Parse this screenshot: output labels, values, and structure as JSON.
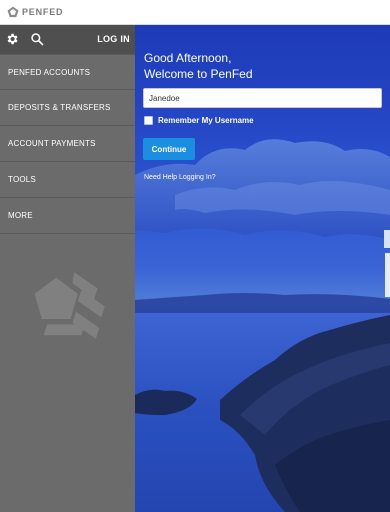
{
  "brand": {
    "name": "PENFED",
    "logo_icon": "penfed-pentagon-logo-icon"
  },
  "sidebar": {
    "settings_icon": "gear-icon",
    "search_icon": "search-icon",
    "login_label": "LOG IN",
    "items": [
      {
        "label": "PENFED ACCOUNTS"
      },
      {
        "label": "DEPOSITS & TRANSFERS"
      },
      {
        "label": "ACCOUNT PAYMENTS"
      },
      {
        "label": "TOOLS"
      },
      {
        "label": "MORE"
      }
    ]
  },
  "login": {
    "greeting_line1": "Good Afternoon,",
    "greeting_line2": "Welcome to PenFed",
    "username_value": "Janedoe",
    "remember_label": "Remember My Username",
    "remember_checked": false,
    "continue_label": "Continue",
    "help_link": "Need Help Logging In?"
  },
  "colors": {
    "topbar_bg": "#ffffff",
    "sidebar_bg": "#6b6b6b",
    "sidebar_header_bg": "#4f4f4f",
    "accent_button": "#1a8fe0",
    "hero_sky": "#2445c4"
  }
}
